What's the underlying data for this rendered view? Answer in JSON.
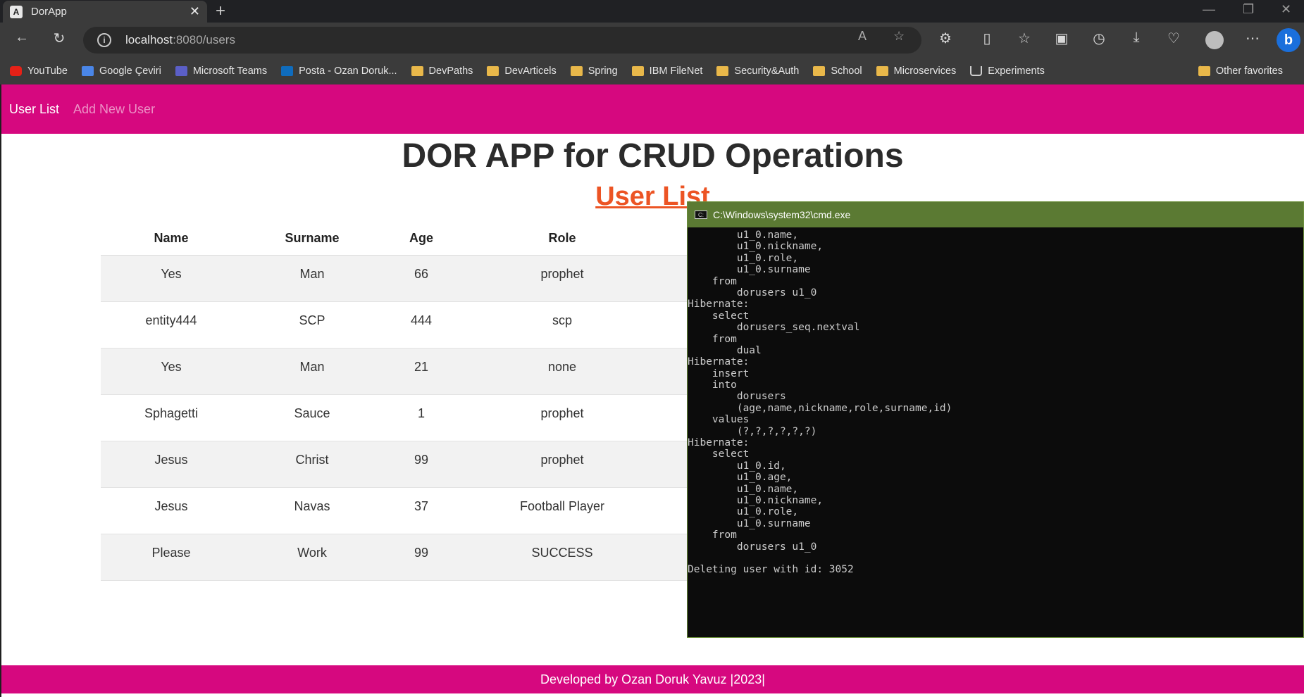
{
  "browser": {
    "tab_title": "DorApp",
    "tab_favicon": "A",
    "address_host": "localhost",
    "address_path": ":8080/users",
    "bookmarks": [
      {
        "label": "YouTube",
        "icon": "yt"
      },
      {
        "label": "Google Çeviri",
        "icon": "gt"
      },
      {
        "label": "Microsoft Teams",
        "icon": "ms"
      },
      {
        "label": "Posta - Ozan Doruk...",
        "icon": "ol"
      },
      {
        "label": "DevPaths",
        "icon": "fold"
      },
      {
        "label": "DevArticels",
        "icon": "fold"
      },
      {
        "label": "Spring",
        "icon": "fold"
      },
      {
        "label": "IBM FileNet",
        "icon": "fold"
      },
      {
        "label": "Security&Auth",
        "icon": "fold"
      },
      {
        "label": "School",
        "icon": "fold"
      },
      {
        "label": "Microservices",
        "icon": "fold"
      },
      {
        "label": "Experiments",
        "icon": "flask"
      }
    ],
    "other_favorites": "Other favorites"
  },
  "app": {
    "nav": {
      "user_list": "User List",
      "add_new_user": "Add New User"
    },
    "title": "DOR APP for CRUD Operations",
    "subtitle": "User List",
    "table": {
      "headers": [
        "Name",
        "Surname",
        "Age",
        "Role"
      ],
      "rows": [
        [
          "Yes",
          "Man",
          "66",
          "prophet"
        ],
        [
          "entity444",
          "SCP",
          "444",
          "scp"
        ],
        [
          "Yes",
          "Man",
          "21",
          "none"
        ],
        [
          "Sphagetti",
          "Sauce",
          "1",
          "prophet"
        ],
        [
          "Jesus",
          "Christ",
          "99",
          "prophet"
        ],
        [
          "Jesus",
          "Navas",
          "37",
          "Football Player"
        ],
        [
          "Please",
          "Work",
          "99",
          "SUCCESS"
        ]
      ]
    },
    "footer": "Developed by Ozan Doruk Yavuz |2023|"
  },
  "cmd": {
    "title": "C:\\Windows\\system32\\cmd.exe",
    "lines": [
      "        u1_0.name,",
      "        u1_0.nickname,",
      "        u1_0.role,",
      "        u1_0.surname",
      "    from",
      "        dorusers u1_0",
      "Hibernate:",
      "    select",
      "        dorusers_seq.nextval",
      "    from",
      "        dual",
      "Hibernate:",
      "    insert",
      "    into",
      "        dorusers",
      "        (age,name,nickname,role,surname,id)",
      "    values",
      "        (?,?,?,?,?,?)",
      "Hibernate:",
      "    select",
      "        u1_0.id,",
      "        u1_0.age,",
      "        u1_0.name,",
      "        u1_0.nickname,",
      "        u1_0.role,",
      "        u1_0.surname",
      "    from",
      "        dorusers u1_0",
      "",
      "Deleting user with id: 3052"
    ]
  }
}
